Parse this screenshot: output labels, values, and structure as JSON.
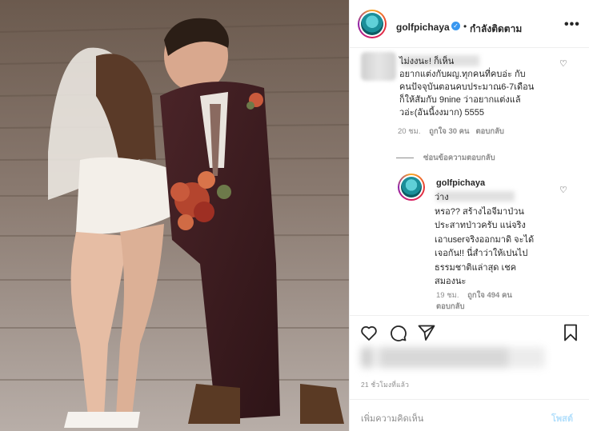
{
  "post": {
    "username": "golfpichaya",
    "separator": "•",
    "follow_label": "กำลังติดตาม",
    "more_label": "•••",
    "verified_glyph": "✓"
  },
  "comments": [
    {
      "text": "ไม่งงนะ! ก็เห็น\nอยากแต่งกับผญ.ทุกคนที่คบอ่ะ กับ\nคนปัจจุบันตอนคบประมาณ6-7เดือน\nก็ให้สัมกับ 9nine ว่าอยากแต่งแล้\nวอ่ะ(อันนี้งงมาก) 5555",
      "age": "20 ชม.",
      "likes": "ถูกใจ 30 คน",
      "reply_label": "ตอบกลับ"
    }
  ],
  "hide_replies_label": "ซ่อนข้อความตอบกลับ",
  "reply": {
    "username": "golfpichaya",
    "text": "                       ว่าง\nหรอ?? สร้างไอจีมาป่วน\nประสาทป่าวครับ แน่จริง\nเอาuserจริงออกมาดิ จะได้\nเจอกัน!! นี่สำว่าให้เปนไป\nธรรมชาติแล่าสุด เชค\nสมองนะ",
    "age": "19 ชม.",
    "likes": "ถูกใจ 494 คน",
    "reply_label": "ตอบกลับ"
  },
  "time_ago": "21 ชั่วโมงที่แล้ว",
  "comment_placeholder": "เพิ่มความคิดเห็น",
  "post_label": "โพสต์",
  "icons": [
    "heart-icon",
    "comment-icon",
    "share-icon",
    "bookmark-icon",
    "more-icon",
    "verified-icon"
  ],
  "colors": {
    "link_blue": "#3897f0",
    "post_disabled": "#b2dffc",
    "meta_gray": "#8e8e8e"
  }
}
